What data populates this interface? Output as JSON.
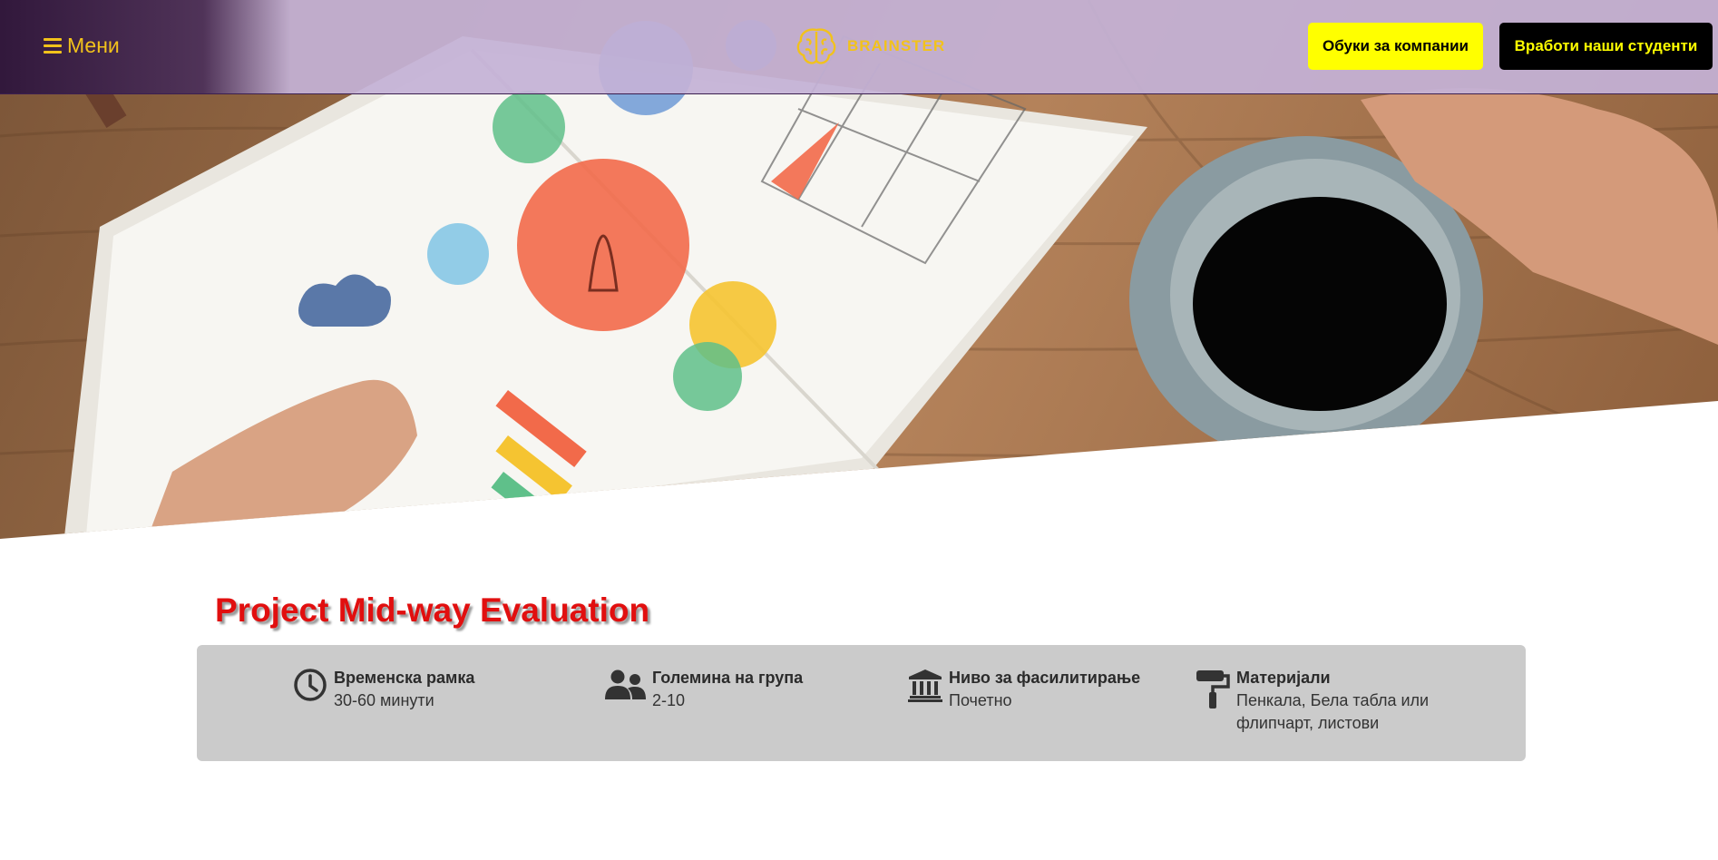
{
  "nav": {
    "menu_label": "Мени",
    "logo_text": "BRAINSTER",
    "btn_companies": "Обуки за компании",
    "btn_hire": "Вработи наши студенти"
  },
  "hero": {
    "image": "notebook-startup-sketch-with-coffee-cup"
  },
  "page_title": "Project Mid-way Evaluation",
  "info": {
    "items": [
      {
        "icon": "clock-icon",
        "label": "Временска рамка",
        "value": "30-60 минути"
      },
      {
        "icon": "users-icon",
        "label": "Големина на група",
        "value": "2-10"
      },
      {
        "icon": "institution-icon",
        "label": "Ниво за фасилитирање",
        "value": "Почетно"
      },
      {
        "icon": "paint-roller-icon",
        "label": "Материјали",
        "value": "Пенкала, Бела табла или флипчарт, листови"
      }
    ]
  },
  "colors": {
    "accent_yellow": "#ffff00",
    "brand_gold": "#f2c21b",
    "title_red": "#e10f0f",
    "panel_gray": "#cbcbcb",
    "nav_lavender": "#c4b2d6"
  }
}
